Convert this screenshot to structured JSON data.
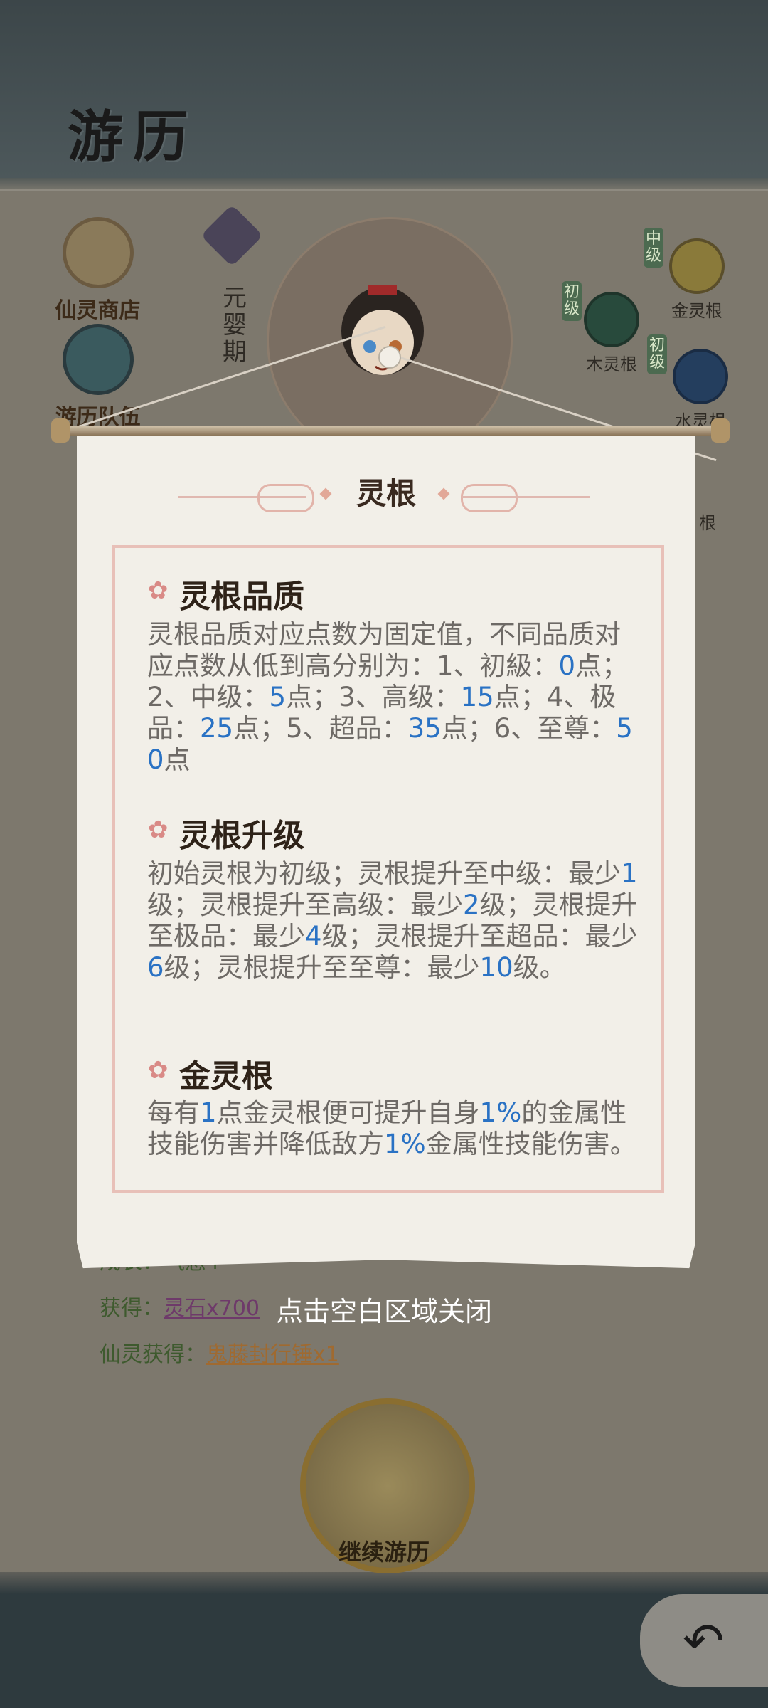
{
  "header": {
    "title": "游历"
  },
  "left_menu": [
    {
      "label": "仙灵商店"
    },
    {
      "label": "游历队伍"
    }
  ],
  "realm": {
    "label": "元婴期"
  },
  "spirit_roots": [
    {
      "label": "金灵根",
      "grade": "中级",
      "color": "#d8c040"
    },
    {
      "label": "木灵根",
      "grade": "初级",
      "color": "#3f8a5a"
    },
    {
      "label": "水灵根",
      "grade": "初级",
      "color": "#3a70c8"
    },
    {
      "label": "根"
    }
  ],
  "log": {
    "growth_label": "成长：",
    "growth_value": "气感+",
    "gain_label": "获得：",
    "gain_value": "灵石x700",
    "spirit_gain_label": "仙灵获得：",
    "spirit_gain_value": "鬼藤封行锤x1"
  },
  "continue_button": {
    "label": "继续游历"
  },
  "back_button": {
    "icon": "back-arrow-icon"
  },
  "modal": {
    "title": "灵根",
    "sections": [
      {
        "heading": "灵根品质",
        "text_parts": [
          {
            "t": "灵根品质对应点数为固定值，不同品质对应点数从低到高分别为：1、初級："
          },
          {
            "t": "0",
            "hl": true
          },
          {
            "t": "点；2、中级："
          },
          {
            "t": "5",
            "hl": true
          },
          {
            "t": "点；3、高级："
          },
          {
            "t": "15",
            "hl": true
          },
          {
            "t": "点；4、极品："
          },
          {
            "t": "25",
            "hl": true
          },
          {
            "t": "点；5、超品："
          },
          {
            "t": "35",
            "hl": true
          },
          {
            "t": "点；6、至尊："
          },
          {
            "t": "50",
            "hl": true
          },
          {
            "t": "点"
          }
        ]
      },
      {
        "heading": "灵根升级",
        "text_parts": [
          {
            "t": "初始灵根为初级；灵根提升至中级：最少"
          },
          {
            "t": "1",
            "hl": true
          },
          {
            "t": "级；灵根提升至高级：最少"
          },
          {
            "t": "2",
            "hl": true
          },
          {
            "t": "级；灵根提升至极品：最少"
          },
          {
            "t": "4",
            "hl": true
          },
          {
            "t": "级；灵根提升至超品：最少"
          },
          {
            "t": "6",
            "hl": true
          },
          {
            "t": "级；灵根提升至至尊：最少"
          },
          {
            "t": "10",
            "hl": true
          },
          {
            "t": "级。"
          }
        ]
      },
      {
        "heading": "金灵根",
        "text_parts": [
          {
            "t": "每有"
          },
          {
            "t": "1",
            "hl": true
          },
          {
            "t": "点金灵根便可提升自身"
          },
          {
            "t": "1%",
            "hl": true
          },
          {
            "t": "的金属性技能伤害并降低敌方"
          },
          {
            "t": "1%",
            "hl": true
          },
          {
            "t": "金属性技能伤害。"
          }
        ]
      }
    ],
    "close_hint": "点击空白区域关闭"
  },
  "colors": {
    "highlight": "#2a72c4",
    "scroll_bg": "#f2efe8",
    "border": "#e8c0b8"
  }
}
